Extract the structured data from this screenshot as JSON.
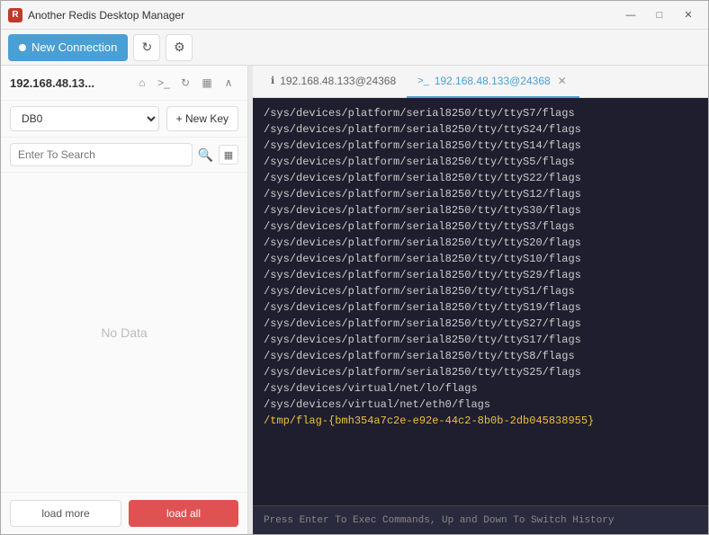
{
  "titlebar": {
    "app_name": "Another Redis Desktop Manager",
    "icon_label": "R",
    "minimize_label": "—",
    "maximize_label": "□",
    "close_label": "✕"
  },
  "toolbar": {
    "new_connection_label": "New Connection",
    "refresh_icon": "↻",
    "settings_icon": "⚙"
  },
  "left_panel": {
    "connection_name": "192.168.48.13...",
    "home_icon": "⌂",
    "terminal_icon": ">_",
    "refresh_icon": "↻",
    "grid_icon": "▦",
    "collapse_icon": "∧",
    "db_select_value": "DB0",
    "new_key_label": "+ New Key",
    "search_placeholder": "Enter To Search",
    "no_data_label": "No Data",
    "load_more_label": "load more",
    "load_all_label": "load all"
  },
  "tabs": [
    {
      "id": "tab-info",
      "icon": "ℹ",
      "label": "192.168.48.133@24368",
      "closable": false,
      "active": false
    },
    {
      "id": "tab-terminal",
      "icon": ">_",
      "label": "192.168.48.133@24368",
      "closable": true,
      "active": true,
      "close_icon": "✕"
    }
  ],
  "terminal": {
    "lines": [
      "/sys/devices/platform/serial8250/tty/ttyS7/flags",
      "/sys/devices/platform/serial8250/tty/ttyS24/flags",
      "/sys/devices/platform/serial8250/tty/ttyS14/flags",
      "/sys/devices/platform/serial8250/tty/ttyS5/flags",
      "/sys/devices/platform/serial8250/tty/ttyS22/flags",
      "/sys/devices/platform/serial8250/tty/ttyS12/flags",
      "/sys/devices/platform/serial8250/tty/ttyS30/flags",
      "/sys/devices/platform/serial8250/tty/ttyS3/flags",
      "/sys/devices/platform/serial8250/tty/ttyS20/flags",
      "/sys/devices/platform/serial8250/tty/ttyS10/flags",
      "/sys/devices/platform/serial8250/tty/ttyS29/flags",
      "/sys/devices/platform/serial8250/tty/ttyS1/flags",
      "/sys/devices/platform/serial8250/tty/ttyS19/flags",
      "/sys/devices/platform/serial8250/tty/ttyS27/flags",
      "/sys/devices/platform/serial8250/tty/ttyS17/flags",
      "/sys/devices/platform/serial8250/tty/ttyS8/flags",
      "/sys/devices/platform/serial8250/tty/ttyS25/flags",
      "/sys/devices/virtual/net/lo/flags",
      "/sys/devices/virtual/net/eth0/flags",
      "/tmp/flag-{bmh354a7c2e-e92e-44c2-8b0b-2db045838955}"
    ],
    "input_hint": "Press Enter To Exec Commands, Up and Down To Switch History"
  },
  "colors": {
    "accent": "#4a9fd4",
    "terminal_bg": "#1e1e2e",
    "terminal_input_bg": "#2a2a3e",
    "load_all_bg": "#e05252",
    "highlight": "#f0c040"
  }
}
